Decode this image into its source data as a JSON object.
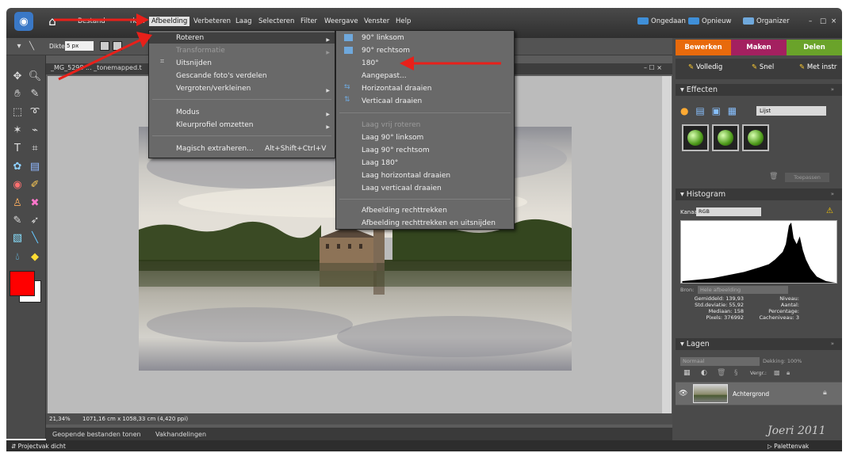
{
  "app": {
    "menus": [
      "Bestand",
      "Bewerken",
      "Afbeelding",
      "Verbeteren",
      "Laag",
      "Selecteren",
      "Filter",
      "Weergave",
      "Venster",
      "Help"
    ],
    "visible_menu_fragments": {
      "bestand": "Bestand",
      "bewerken": "rken"
    },
    "right_menu": {
      "undo": "Ongedaan",
      "redo": "Opnieuw",
      "organizer": "Organizer",
      "minimize": "–",
      "restore": "□",
      "close": "×"
    },
    "colors": {
      "menubar": "#3a3a3a",
      "accent_bewerken": "#e86a0c",
      "accent_maken": "#a42060",
      "accent_delen": "#6aa32a",
      "foreground_color": "#ff0000",
      "arrow": "#e8201a"
    }
  },
  "options_bar": {
    "dikte_label": "Dikte:",
    "dikte_value": "5 px"
  },
  "document": {
    "title": "_MG_5298 ... _tonemapped.t",
    "window_controls": "– ☐ ×",
    "zoom": "21,34%",
    "doc_size": "1071,16 cm x 1058,33 cm (4,420 ppi)",
    "bottom_tabs": [
      "Geopende bestanden tonen",
      "Vakhandelingen"
    ]
  },
  "menu_afbeelding": {
    "items": [
      {
        "label": "Roteren",
        "submenu": true,
        "disabled": false,
        "highlighted": true
      },
      {
        "label": "Transformatie",
        "submenu": true,
        "disabled": true
      },
      {
        "label": "Uitsnijden",
        "submenu": false,
        "disabled": false,
        "icon": "crop-icon"
      },
      {
        "label": "Gescande foto's verdelen",
        "submenu": false,
        "disabled": false
      },
      {
        "label": "Vergroten/verkleinen",
        "submenu": true,
        "disabled": false
      },
      {
        "label": "Modus",
        "submenu": true,
        "disabled": false
      },
      {
        "label": "Kleurprofiel omzetten",
        "submenu": true,
        "disabled": false
      },
      {
        "label": "Magisch extraheren...",
        "shortcut": "Alt+Shift+Ctrl+V",
        "submenu": false,
        "disabled": false
      }
    ]
  },
  "menu_roteren": {
    "items": [
      {
        "label": "90° linksom",
        "icon": "rotate-left-icon",
        "disabled": false
      },
      {
        "label": "90° rechtsom",
        "icon": "rotate-right-icon",
        "disabled": false
      },
      {
        "label": "180°",
        "disabled": false
      },
      {
        "label": "Aangepast...",
        "disabled": false
      },
      {
        "label": "Horizontaal draaien",
        "icon": "flip-horizontal-icon",
        "disabled": false
      },
      {
        "label": "Verticaal draaien",
        "icon": "flip-vertical-icon",
        "disabled": false
      },
      {
        "label": "Laag vrij roteren",
        "disabled": true
      },
      {
        "label": "Laag 90° linksom",
        "disabled": false
      },
      {
        "label": "Laag 90° rechtsom",
        "disabled": false
      },
      {
        "label": "Laag 180°",
        "disabled": false
      },
      {
        "label": "Laag horizontaal draaien",
        "disabled": false
      },
      {
        "label": "Laag verticaal draaien",
        "disabled": false
      },
      {
        "label": "Afbeelding rechttrekken",
        "disabled": false
      },
      {
        "label": "Afbeelding rechttrekken en uitsnijden",
        "disabled": false
      }
    ]
  },
  "right_panel": {
    "mode_tabs": [
      "Bewerken",
      "Maken",
      "Delen"
    ],
    "edit_modes": [
      "Volledig",
      "Snel",
      "Met instr"
    ],
    "effecten": {
      "title": "Effecten",
      "select": "Lijst",
      "apply": "Toepassen"
    },
    "histogram": {
      "title": "Histogram",
      "kanaal_label": "Kanaal:",
      "kanaal_value": "RGB",
      "bron_label": "Bron:",
      "bron_value": "Hele afbeelding",
      "stats_left": [
        {
          "label": "Gemiddeld:",
          "value": "139,93"
        },
        {
          "label": "Std.deviatie:",
          "value": "55,92"
        },
        {
          "label": "Mediaan:",
          "value": "158"
        },
        {
          "label": "Pixels:",
          "value": "376992"
        }
      ],
      "stats_right": [
        "Niveau:",
        "Aantal:",
        "Percentage:",
        "Cacheniveau: 3"
      ]
    },
    "lagen": {
      "title": "Lagen",
      "blend_mode": "Normaal",
      "opacity_label": "Dekking:",
      "opacity_value": "100%",
      "lock_label": "Vergr.:",
      "layer_name": "Achtergrond"
    }
  },
  "bottom_bar": {
    "left": "Projectvak dicht",
    "right": "Palettenvak"
  },
  "watermark": "Joeri 2011"
}
